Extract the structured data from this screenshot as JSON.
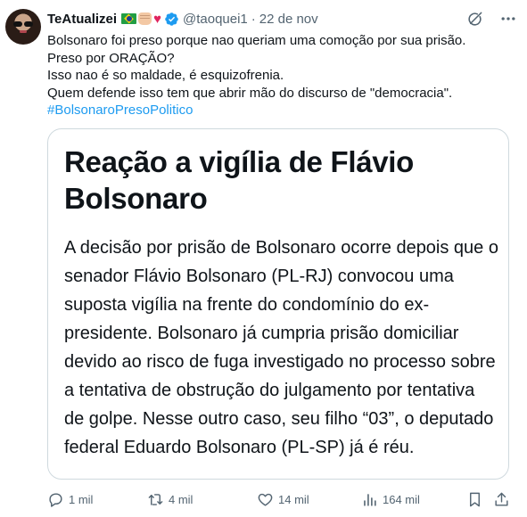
{
  "author": {
    "name": "TeAtualizei",
    "handle": "@taoquei1",
    "separator": "·",
    "date": "22 de nov",
    "emoji_icons": [
      "brazil-flag-icon",
      "fist-icon",
      "red-heart-icon"
    ],
    "verified_icon": "verified-badge-icon"
  },
  "colors": {
    "accent": "#1d9bf0",
    "text": "#0f1419",
    "secondary": "#536471",
    "border": "#cfd9de"
  },
  "tweet": {
    "lines": [
      "Bolsonaro foi preso porque nao queriam uma comoção por sua prisão.",
      "Preso por ORAÇÃO?",
      "Isso nao é so maldade, é esquizofrenia.",
      "Quem defende isso tem que abrir mão do discurso de \"democracia\"."
    ],
    "hashtag": "#BolsonaroPresoPolitico"
  },
  "card": {
    "title_lines": [
      "Reação a vigília de Flávio",
      "Bolsonaro"
    ],
    "body_lines": [
      "A decisão por prisão de Bolsonaro ocorre depois que o",
      "senador Flávio Bolsonaro (PL-RJ) convocou uma",
      "suposta vigília na frente do condomínio do ex-",
      "presidente. Bolsonaro já cumpria prisão domiciliar",
      "devido ao risco de fuga investigado no processo sobre",
      "a tentativa de obstrução do julgamento por tentativa",
      "de golpe. Nesse outro caso, seu filho “03”, o deputado",
      "federal Eduardo Bolsonaro (PL-SP) já é réu."
    ]
  },
  "actions": {
    "replies": "1 mil",
    "reposts": "4 mil",
    "likes": "14 mil",
    "views": "164 mil"
  }
}
